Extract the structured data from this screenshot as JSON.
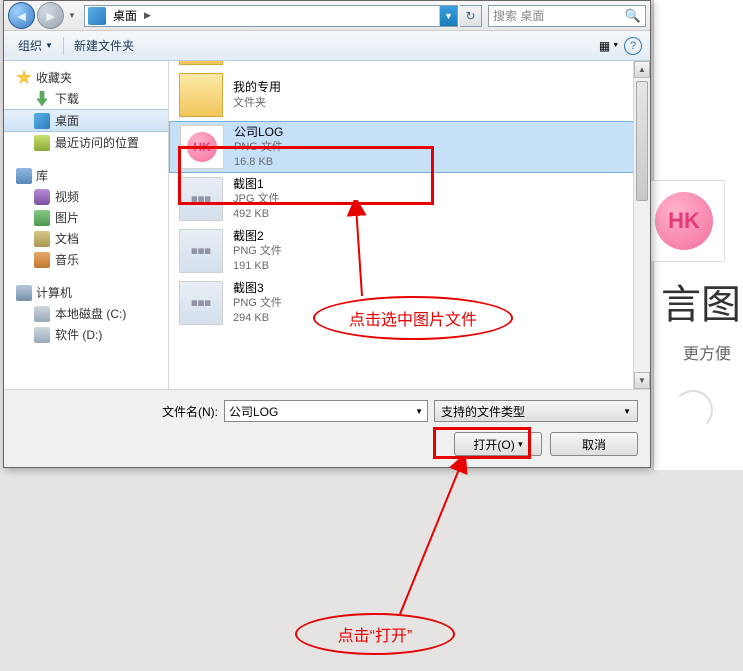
{
  "nav": {
    "path_segment": "桌面",
    "search_placeholder": "搜索 桌面"
  },
  "toolbar": {
    "organize": "组织",
    "newfolder": "新建文件夹"
  },
  "tree": {
    "favorites": "收藏夹",
    "downloads": "下载",
    "desktop": "桌面",
    "recent": "最近访问的位置",
    "libraries": "库",
    "videos": "视频",
    "pictures": "图片",
    "documents": "文档",
    "music": "音乐",
    "computer": "计算机",
    "drive_c": "本地磁盘 (C:)",
    "drive_d": "软件 (D:)"
  },
  "files": [
    {
      "name": "",
      "type": "文件夹",
      "size": ""
    },
    {
      "name": "我的专用",
      "type": "文件夹",
      "size": ""
    },
    {
      "name": "公司LOG",
      "type": "PNG 文件",
      "size": "16.8 KB"
    },
    {
      "name": "截图1",
      "type": "JPG 文件",
      "size": "492 KB"
    },
    {
      "name": "截图2",
      "type": "PNG 文件",
      "size": "191 KB"
    },
    {
      "name": "截图3",
      "type": "PNG 文件",
      "size": "294 KB"
    }
  ],
  "bottom": {
    "filename_label": "文件名(N):",
    "filename_value": "公司LOG",
    "filter_label": "支持的文件类型",
    "open": "打开(O)",
    "cancel": "取消"
  },
  "annot": {
    "tip1": "点击选中图片文件",
    "tip2": "点击“打开”"
  },
  "bg": {
    "hk": "HK",
    "t1": "言图",
    "t2": "更方便"
  }
}
